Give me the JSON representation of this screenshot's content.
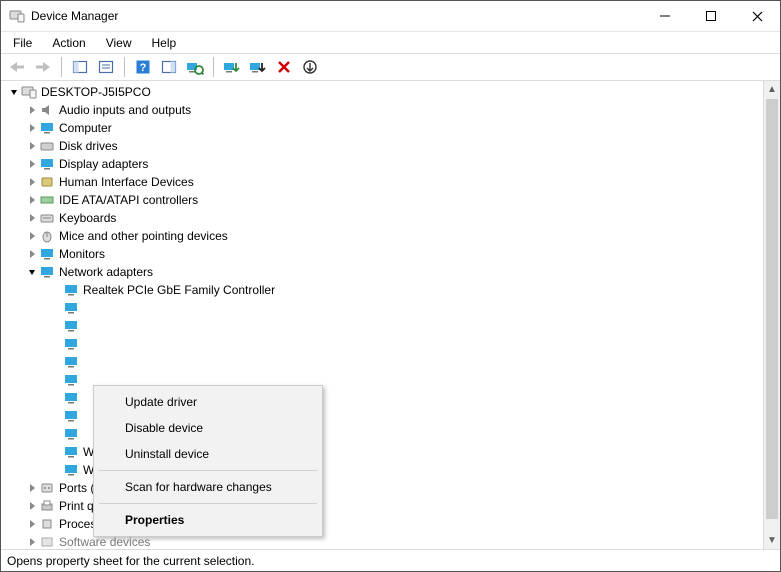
{
  "titlebar": {
    "title": "Device Manager"
  },
  "menu": {
    "file": "File",
    "action": "Action",
    "view": "View",
    "help": "Help"
  },
  "tree": {
    "root": "DESKTOP-J5I5PCO",
    "categories": [
      {
        "label": "Audio inputs and outputs"
      },
      {
        "label": "Computer"
      },
      {
        "label": "Disk drives"
      },
      {
        "label": "Display adapters"
      },
      {
        "label": "Human Interface Devices"
      },
      {
        "label": "IDE ATA/ATAPI controllers"
      },
      {
        "label": "Keyboards"
      },
      {
        "label": "Mice and other pointing devices"
      },
      {
        "label": "Monitors"
      },
      {
        "label": "Network adapters",
        "expanded": true
      },
      {
        "label": "Ports (COM & LPT)"
      },
      {
        "label": "Print queues"
      },
      {
        "label": "Processors"
      },
      {
        "label": "Software devices"
      }
    ],
    "network_children_visible": [
      "Realtek PCIe GbE Family Controller",
      "WAN Miniport (PPTP)",
      "WAN Miniport (SSTP)"
    ],
    "hidden_network_count": 8
  },
  "context_menu": {
    "update": "Update driver",
    "disable": "Disable device",
    "uninstall": "Uninstall device",
    "scan": "Scan for hardware changes",
    "properties": "Properties"
  },
  "statusbar": {
    "text": "Opens property sheet for the current selection."
  }
}
